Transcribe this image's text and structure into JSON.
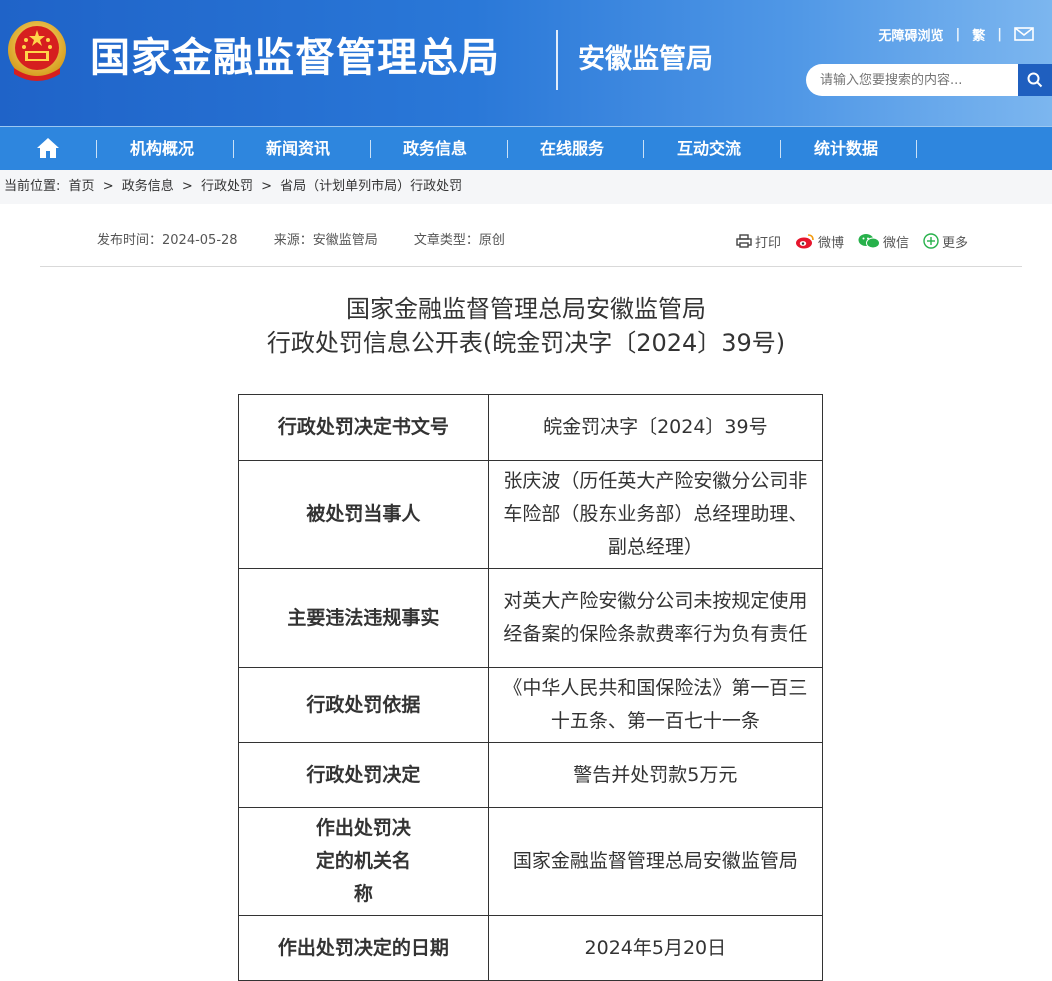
{
  "header": {
    "site_title": "国家金融监督管理总局",
    "sub_title": "安徽监管局",
    "top_links": [
      "无障碍浏览",
      "繁"
    ],
    "search_placeholder": "请输入您要搜索的内容..."
  },
  "nav": {
    "items": [
      "机构概况",
      "新闻资讯",
      "政务信息",
      "在线服务",
      "互动交流",
      "统计数据"
    ]
  },
  "breadcrumb": {
    "label": "当前位置:",
    "items": [
      "首页",
      "政务信息",
      "行政处罚",
      "省局（计划单列市局）行政处罚"
    ]
  },
  "meta": {
    "date": "发布时间：2024-05-28",
    "source": "来源：安徽监管局",
    "type": "文章类型：原创"
  },
  "share": {
    "print": "打印",
    "weibo": "微博",
    "wechat": "微信",
    "more": "更多"
  },
  "doc": {
    "title_line1": "国家金融监督管理总局安徽监管局",
    "title_line2": "行政处罚信息公开表(皖金罚决字〔2024〕39号)"
  },
  "table": {
    "rows": [
      {
        "key": "行政处罚决定书文号",
        "value": "皖金罚决字〔2024〕39号"
      },
      {
        "key": "被处罚当事人",
        "value": "张庆波（历任英大产险安徽分公司非车险部（股东业务部）总经理助理、副总经理）"
      },
      {
        "key": "主要违法违规事实",
        "value": "对英大产险安徽分公司未按规定使用经备案的保险条款费率行为负有责任"
      },
      {
        "key": "行政处罚依据",
        "value": "《中华人民共和国保险法》第一百三十五条、第一百七十一条"
      },
      {
        "key": "行政处罚决定",
        "value": "警告并处罚款5万元"
      },
      {
        "key": "作出处罚决定的机关名称",
        "value": "国家金融监督管理总局安徽监管局"
      },
      {
        "key": "作出处罚决定的日期",
        "value": "2024年5月20日"
      }
    ]
  }
}
